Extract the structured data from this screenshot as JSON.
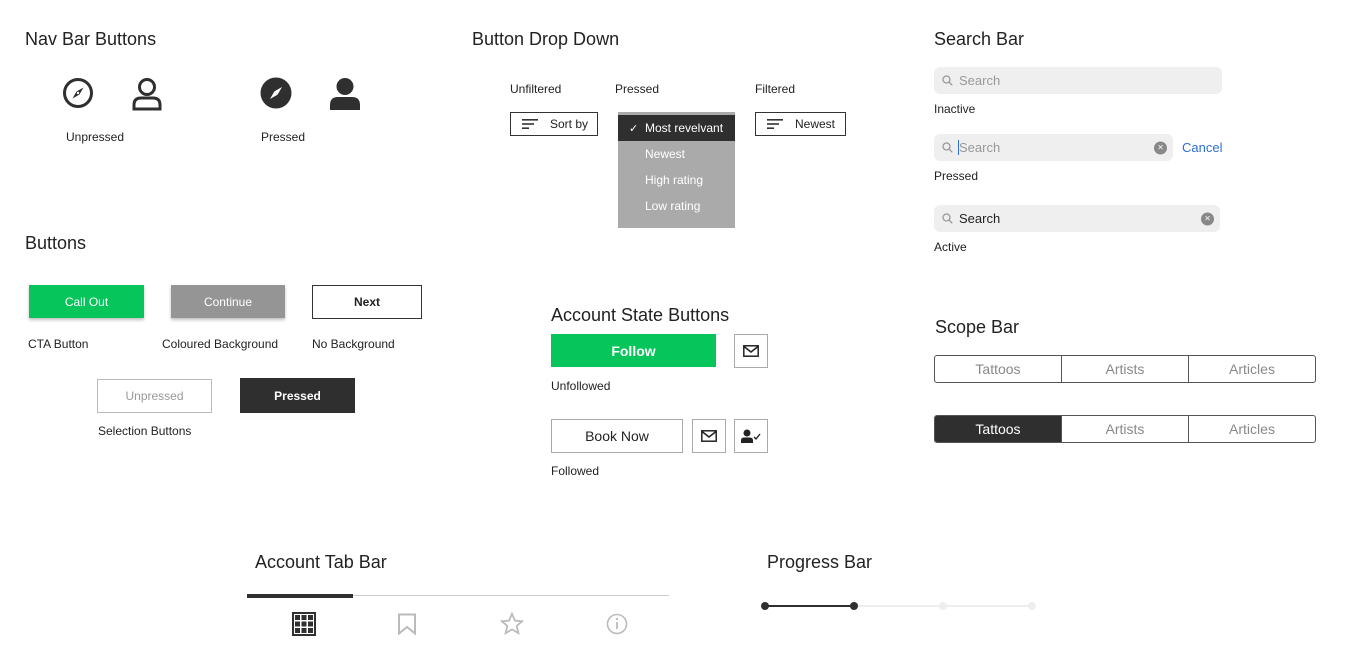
{
  "nav_bar": {
    "title": "Nav Bar Buttons",
    "unpressed_label": "Unpressed",
    "pressed_label": "Pressed",
    "icons": [
      "compass-icon",
      "user-icon"
    ]
  },
  "dropdown": {
    "title": "Button Drop Down",
    "unfiltered_label": "Unfiltered",
    "pressed_label": "Pressed",
    "filtered_label": "Filtered",
    "sort_by": "Sort by",
    "filtered_value": "Newest",
    "options": [
      "Most revelvant",
      "Newest",
      "High rating",
      "Low rating"
    ],
    "selected_index": 0,
    "check": "✓"
  },
  "search_bar": {
    "title": "Search Bar",
    "placeholder": "Search",
    "inactive_label": "Inactive",
    "pressed_label": "Pressed",
    "active_label": "Active",
    "cancel": "Cancel",
    "active_value": "Search"
  },
  "buttons": {
    "title": "Buttons",
    "call_out": "Call Out",
    "continue": "Continue",
    "next": "Next",
    "cta_caption": "CTA Button",
    "coloured_caption": "Coloured Background",
    "nobg_caption": "No Background",
    "unpressed": "Unpressed",
    "pressed": "Pressed",
    "selection_caption": "Selection Buttons"
  },
  "account_state": {
    "title": "Account State Buttons",
    "follow": "Follow",
    "unfollowed_label": "Unfollowed",
    "book_now": "Book Now",
    "followed_label": "Followed"
  },
  "scope_bar": {
    "title": "Scope Bar",
    "segments": [
      "Tattoos",
      "Artists",
      "Articles"
    ]
  },
  "account_tab_bar": {
    "title": "Account Tab Bar",
    "tabs": [
      "grid-icon",
      "bookmark-icon",
      "star-icon",
      "info-icon"
    ],
    "active_index": 0
  },
  "progress_bar": {
    "title": "Progress Bar",
    "steps": 4,
    "current_step": 2
  },
  "colors": {
    "cta_green": "#06c55a",
    "dark": "#2f2f2f",
    "link_blue": "#2f6fd8",
    "grey_button": "#959595",
    "dropdown_bg": "#aaaaaa"
  }
}
